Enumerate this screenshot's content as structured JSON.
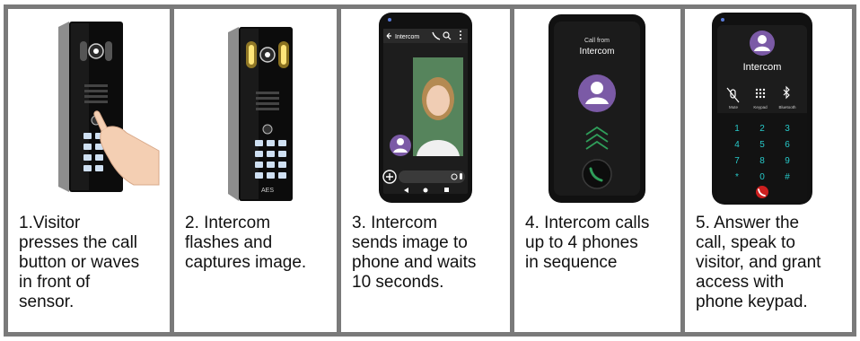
{
  "steps": [
    {
      "caption": "1.Visitor\npresses the call\nbutton or waves\nin front of\nsensor."
    },
    {
      "caption": "  2. Intercom\nflashes and\ncaptures image."
    },
    {
      "caption": "3. Intercom\nsends image to\nphone and waits\n10 seconds."
    },
    {
      "caption": "4. Intercom calls\nup to 4 phones\nin sequence"
    },
    {
      "caption": "5. Answer the\ncall, speak to\nvisitor, and grant\naccess with\nphone keypad."
    }
  ],
  "device_logo": "AES",
  "phone3": {
    "contact": "Intercom"
  },
  "phone4": {
    "call_from": "Call from",
    "caller": "Intercom"
  },
  "phone5": {
    "caller": "Intercom",
    "controls": [
      "Mute",
      "Keypad",
      "Bluetooth"
    ],
    "keys": [
      "1",
      "2",
      "3",
      "4",
      "5",
      "6",
      "7",
      "8",
      "9",
      "*",
      "0",
      "#"
    ]
  },
  "colors": {
    "border": "#7a7a7a",
    "accent_purple": "#7b5aa6",
    "call_green": "#2f9e5a",
    "key_cyan": "#27c9c9",
    "hangup_red": "#cc1f1f"
  }
}
